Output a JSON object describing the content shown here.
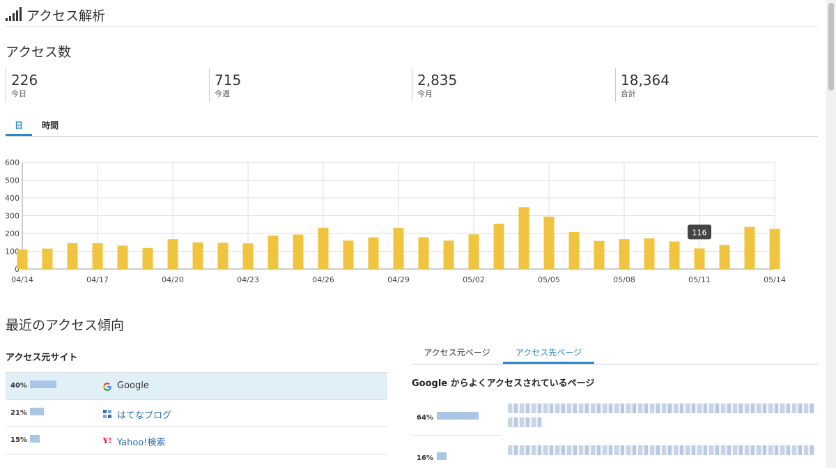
{
  "header": {
    "title": "アクセス解析",
    "icon": "signal-bars-icon"
  },
  "access_count": {
    "title": "アクセス数",
    "stats": [
      {
        "value": "226",
        "label": "今日"
      },
      {
        "value": "715",
        "label": "今週"
      },
      {
        "value": "2,835",
        "label": "今月"
      },
      {
        "value": "18,364",
        "label": "合計"
      }
    ],
    "tabs": [
      {
        "label": "日",
        "active": true
      },
      {
        "label": "時間",
        "active": false
      }
    ]
  },
  "chart_data": {
    "type": "bar",
    "categories": [
      "04/14",
      "04/15",
      "04/16",
      "04/17",
      "04/18",
      "04/19",
      "04/20",
      "04/21",
      "04/22",
      "04/23",
      "04/24",
      "04/25",
      "04/26",
      "04/27",
      "04/28",
      "04/29",
      "04/30",
      "05/01",
      "05/02",
      "05/03",
      "05/04",
      "05/05",
      "05/06",
      "05/07",
      "05/08",
      "05/09",
      "05/10",
      "05/11",
      "05/12",
      "05/13",
      "05/14"
    ],
    "tick_labels": [
      "04/14",
      "04/17",
      "04/20",
      "04/23",
      "04/26",
      "04/29",
      "05/02",
      "05/05",
      "05/08",
      "05/11",
      "05/14"
    ],
    "values": [
      110,
      115,
      145,
      145,
      132,
      118,
      168,
      150,
      148,
      144,
      188,
      194,
      232,
      160,
      178,
      232,
      178,
      160,
      195,
      255,
      348,
      295,
      208,
      158,
      168,
      172,
      155,
      116,
      135,
      237,
      226
    ],
    "ylim": [
      0,
      600
    ],
    "yticks": [
      0,
      100,
      200,
      300,
      400,
      500,
      600
    ],
    "grid": true,
    "bar_color": "#f0c43e",
    "tooltip": {
      "category": "05/11",
      "text": "116"
    }
  },
  "trends": {
    "title": "最近のアクセス傾向",
    "sources": {
      "title": "アクセス元サイト",
      "rows": [
        {
          "pct": "40%",
          "share": 0.4,
          "icon": "google-icon",
          "name": "Google",
          "highlight": true
        },
        {
          "pct": "21%",
          "share": 0.21,
          "icon": "hatena-blog-icon",
          "name": "はてなブログ",
          "highlight": false
        },
        {
          "pct": "15%",
          "share": 0.15,
          "icon": "yahoo-icon",
          "name": "Yahoo!検索",
          "highlight": false
        }
      ]
    },
    "pages": {
      "tabs": [
        {
          "label": "アクセス元ページ",
          "active": false
        },
        {
          "label": "アクセス先ページ",
          "active": true
        }
      ],
      "subtitle": "Google からよくアクセスされているページ",
      "rows": [
        {
          "pct": "64%",
          "share": 0.64
        },
        {
          "pct": "16%",
          "share": 0.16
        }
      ]
    }
  },
  "colors": {
    "accent": "#2a88c6",
    "bar": "#f0c43e",
    "share_bar": "#a9c7e5",
    "highlight_row": "#e1eff6"
  }
}
